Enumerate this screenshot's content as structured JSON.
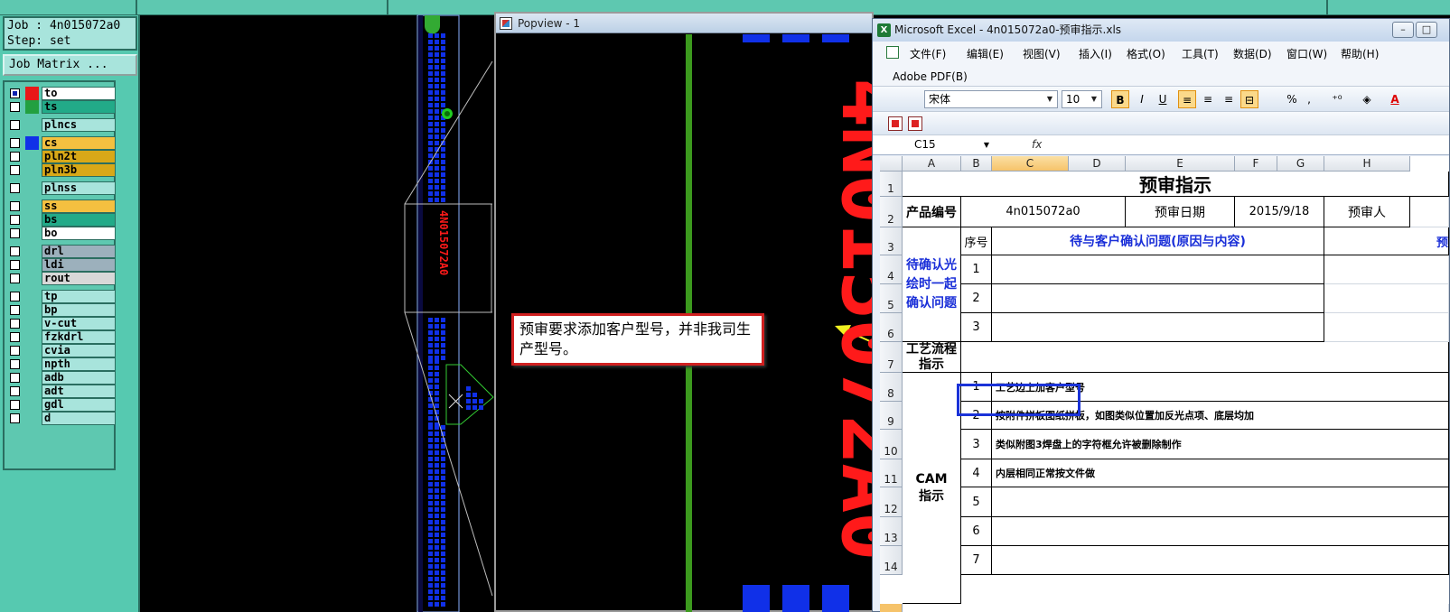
{
  "app": {
    "job_label": "Job : 4n015072a0",
    "step_label": "Step: set",
    "job_matrix_button": "Job Matrix ..."
  },
  "layers": [
    {
      "name": "to",
      "checked": true,
      "swatch": "#e81818",
      "name_bg": "#ffffff"
    },
    {
      "name": "ts",
      "checked": false,
      "swatch": "#22a040",
      "name_bg": "#22aa88"
    },
    {
      "name": "plncs",
      "checked": false,
      "swatch": "",
      "name_bg": "#a8e4dc"
    },
    {
      "name": "cs",
      "checked": false,
      "swatch": "#1030e8",
      "name_bg": "#f4c040"
    },
    {
      "name": "pln2t",
      "checked": false,
      "swatch": "",
      "name_bg": "#d8a818"
    },
    {
      "name": "pln3b",
      "checked": false,
      "swatch": "",
      "name_bg": "#d8a818"
    },
    {
      "name": "plnss",
      "checked": false,
      "swatch": "",
      "name_bg": "#a8e4dc"
    },
    {
      "name": "ss",
      "checked": false,
      "swatch": "",
      "name_bg": "#f4c040"
    },
    {
      "name": "bs",
      "checked": false,
      "swatch": "",
      "name_bg": "#22aa88"
    },
    {
      "name": "bo",
      "checked": false,
      "swatch": "",
      "name_bg": "#ffffff"
    },
    {
      "name": "drl",
      "checked": false,
      "swatch": "",
      "name_bg": "#9cb0bc"
    },
    {
      "name": "ldi",
      "checked": false,
      "swatch": "",
      "name_bg": "#9cb0bc"
    },
    {
      "name": "rout",
      "checked": false,
      "swatch": "",
      "name_bg": "#d8d8d8"
    },
    {
      "name": "tp",
      "checked": false,
      "swatch": "",
      "name_bg": "#a8e4dc"
    },
    {
      "name": "bp",
      "checked": false,
      "swatch": "",
      "name_bg": "#a8e4dc"
    },
    {
      "name": "v-cut",
      "checked": false,
      "swatch": "",
      "name_bg": "#a8e4dc"
    },
    {
      "name": "fzkdrl",
      "checked": false,
      "swatch": "",
      "name_bg": "#a8e4dc"
    },
    {
      "name": "cvia",
      "checked": false,
      "swatch": "",
      "name_bg": "#a8e4dc"
    },
    {
      "name": "npth",
      "checked": false,
      "swatch": "",
      "name_bg": "#a8e4dc"
    },
    {
      "name": "adb",
      "checked": false,
      "swatch": "",
      "name_bg": "#a8e4dc"
    },
    {
      "name": "adt",
      "checked": false,
      "swatch": "",
      "name_bg": "#a8e4dc"
    },
    {
      "name": "gdl",
      "checked": false,
      "swatch": "",
      "name_bg": "#a8e4dc"
    },
    {
      "name": "d",
      "checked": false,
      "swatch": "",
      "name_bg": "#a8e4dc"
    }
  ],
  "canvas": {
    "small_label": "4N015072A0"
  },
  "popview": {
    "title": "Popview - 1",
    "big_text": "4N015072A0"
  },
  "callout": {
    "text": "预审要求添加客户型号，并非我司生产型号。"
  },
  "excel": {
    "title": "Microsoft Excel - 4n015072a0-预审指示.xls",
    "window_buttons": [
      "–",
      "□",
      "✕"
    ],
    "menu": [
      "文件(F)",
      "编辑(E)",
      "视图(V)",
      "插入(I)",
      "格式(O)",
      "工具(T)",
      "数据(D)",
      "窗口(W)",
      "帮助(H)"
    ],
    "menu2": "Adobe PDF(B)",
    "font_name": "宋体",
    "font_size": "10",
    "toolbar_buttons": [
      "B",
      "I",
      "U",
      "%",
      ",",
      "A"
    ],
    "name_box": "C15",
    "fx": "fx",
    "columns": [
      "A",
      "B",
      "C",
      "D",
      "E",
      "F",
      "G",
      "H"
    ],
    "rows": [
      "1",
      "2",
      "3",
      "4",
      "5",
      "6",
      "7",
      "8",
      "9",
      "10",
      "11",
      "12",
      "13",
      "14"
    ],
    "cells": {
      "title": "预审指示",
      "product_no_label": "产品编号",
      "product_no": "4n015072a0",
      "review_date_label": "预审日期",
      "review_date": "2015/9/18",
      "reviewer_label": "预审人",
      "pending_label": "待确认光绘时一起确认问题",
      "seq_label": "序号",
      "issue_header": "待与客户确认问题(原因与内容)",
      "col_h_header": "预",
      "seq_1": "1",
      "seq_2": "2",
      "seq_3": "3",
      "process_label": "工艺流程指示",
      "cam_label": "CAM指示",
      "cam_seq": [
        "1",
        "2",
        "3",
        "4",
        "5",
        "6",
        "7"
      ],
      "cam_items": [
        "工艺边上加客户型号",
        "按附件拼板图纸拼板，如图类似位置加反光点项、底层均加",
        "类似附图3焊盘上的字符框允许被删除制作",
        "内层相同正常按文件做",
        "",
        "",
        ""
      ]
    }
  },
  "colors": {
    "panel_teal": "#56c9b0",
    "pcb_blue": "#1030e8",
    "text_red": "#ff1a1a",
    "highlight_blue": "#1a32d8",
    "callout_red": "#d02020"
  }
}
